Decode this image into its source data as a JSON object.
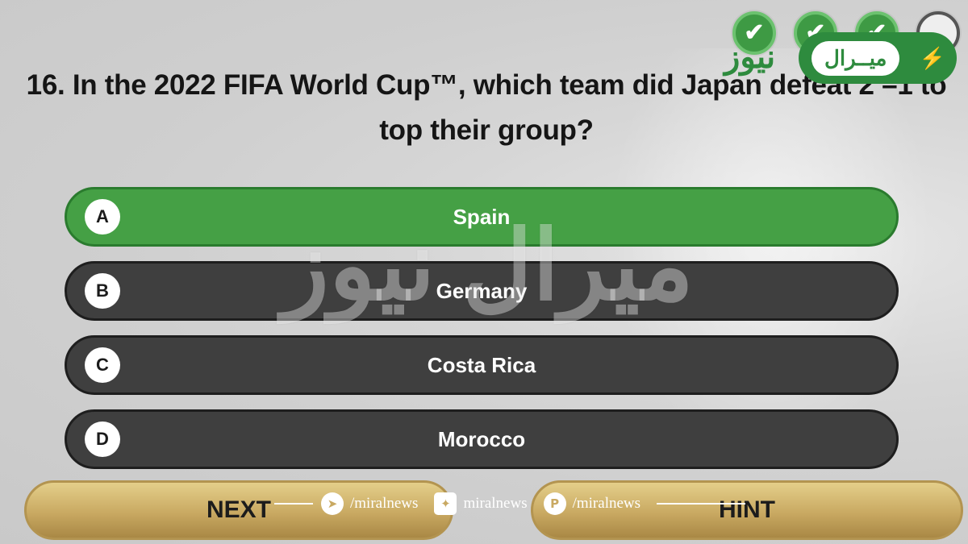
{
  "progress": {
    "steps": [
      {
        "state": "done",
        "glyph": "✔"
      },
      {
        "state": "done",
        "glyph": "✔"
      },
      {
        "state": "done",
        "glyph": "✔"
      },
      {
        "state": "pending",
        "glyph": ""
      }
    ]
  },
  "logo": {
    "pill_text": "ميــرال",
    "word": "نيوز",
    "bolt": "⚡"
  },
  "question": {
    "text": "16. In the 2022 FIFA World Cup™, which team did Japan defeat 2 –1 to top their group?"
  },
  "answers": [
    {
      "letter": "A",
      "text": "Spain",
      "state": "correct"
    },
    {
      "letter": "B",
      "text": "Germany",
      "state": "default"
    },
    {
      "letter": "C",
      "text": "Costa Rica",
      "state": "default"
    },
    {
      "letter": "D",
      "text": "Morocco",
      "state": "default"
    }
  ],
  "buttons": {
    "next_label": "NEXT",
    "hint_label": "HINT"
  },
  "watermark": {
    "text": "ميرال نيوز"
  },
  "social": [
    {
      "icon": "telegram-icon",
      "glyph": "➤",
      "handle": "/miralnews"
    },
    {
      "icon": "twitter-icon",
      "glyph": "✦",
      "handle": "miralnews"
    },
    {
      "icon": "pinterest-icon",
      "glyph": "P",
      "handle": "/miralnews"
    }
  ],
  "colors": {
    "correct_green": "#45a045",
    "answer_dark": "#3f3f3f",
    "gold": "#c9a962",
    "brand_green": "#2e8b3e"
  }
}
